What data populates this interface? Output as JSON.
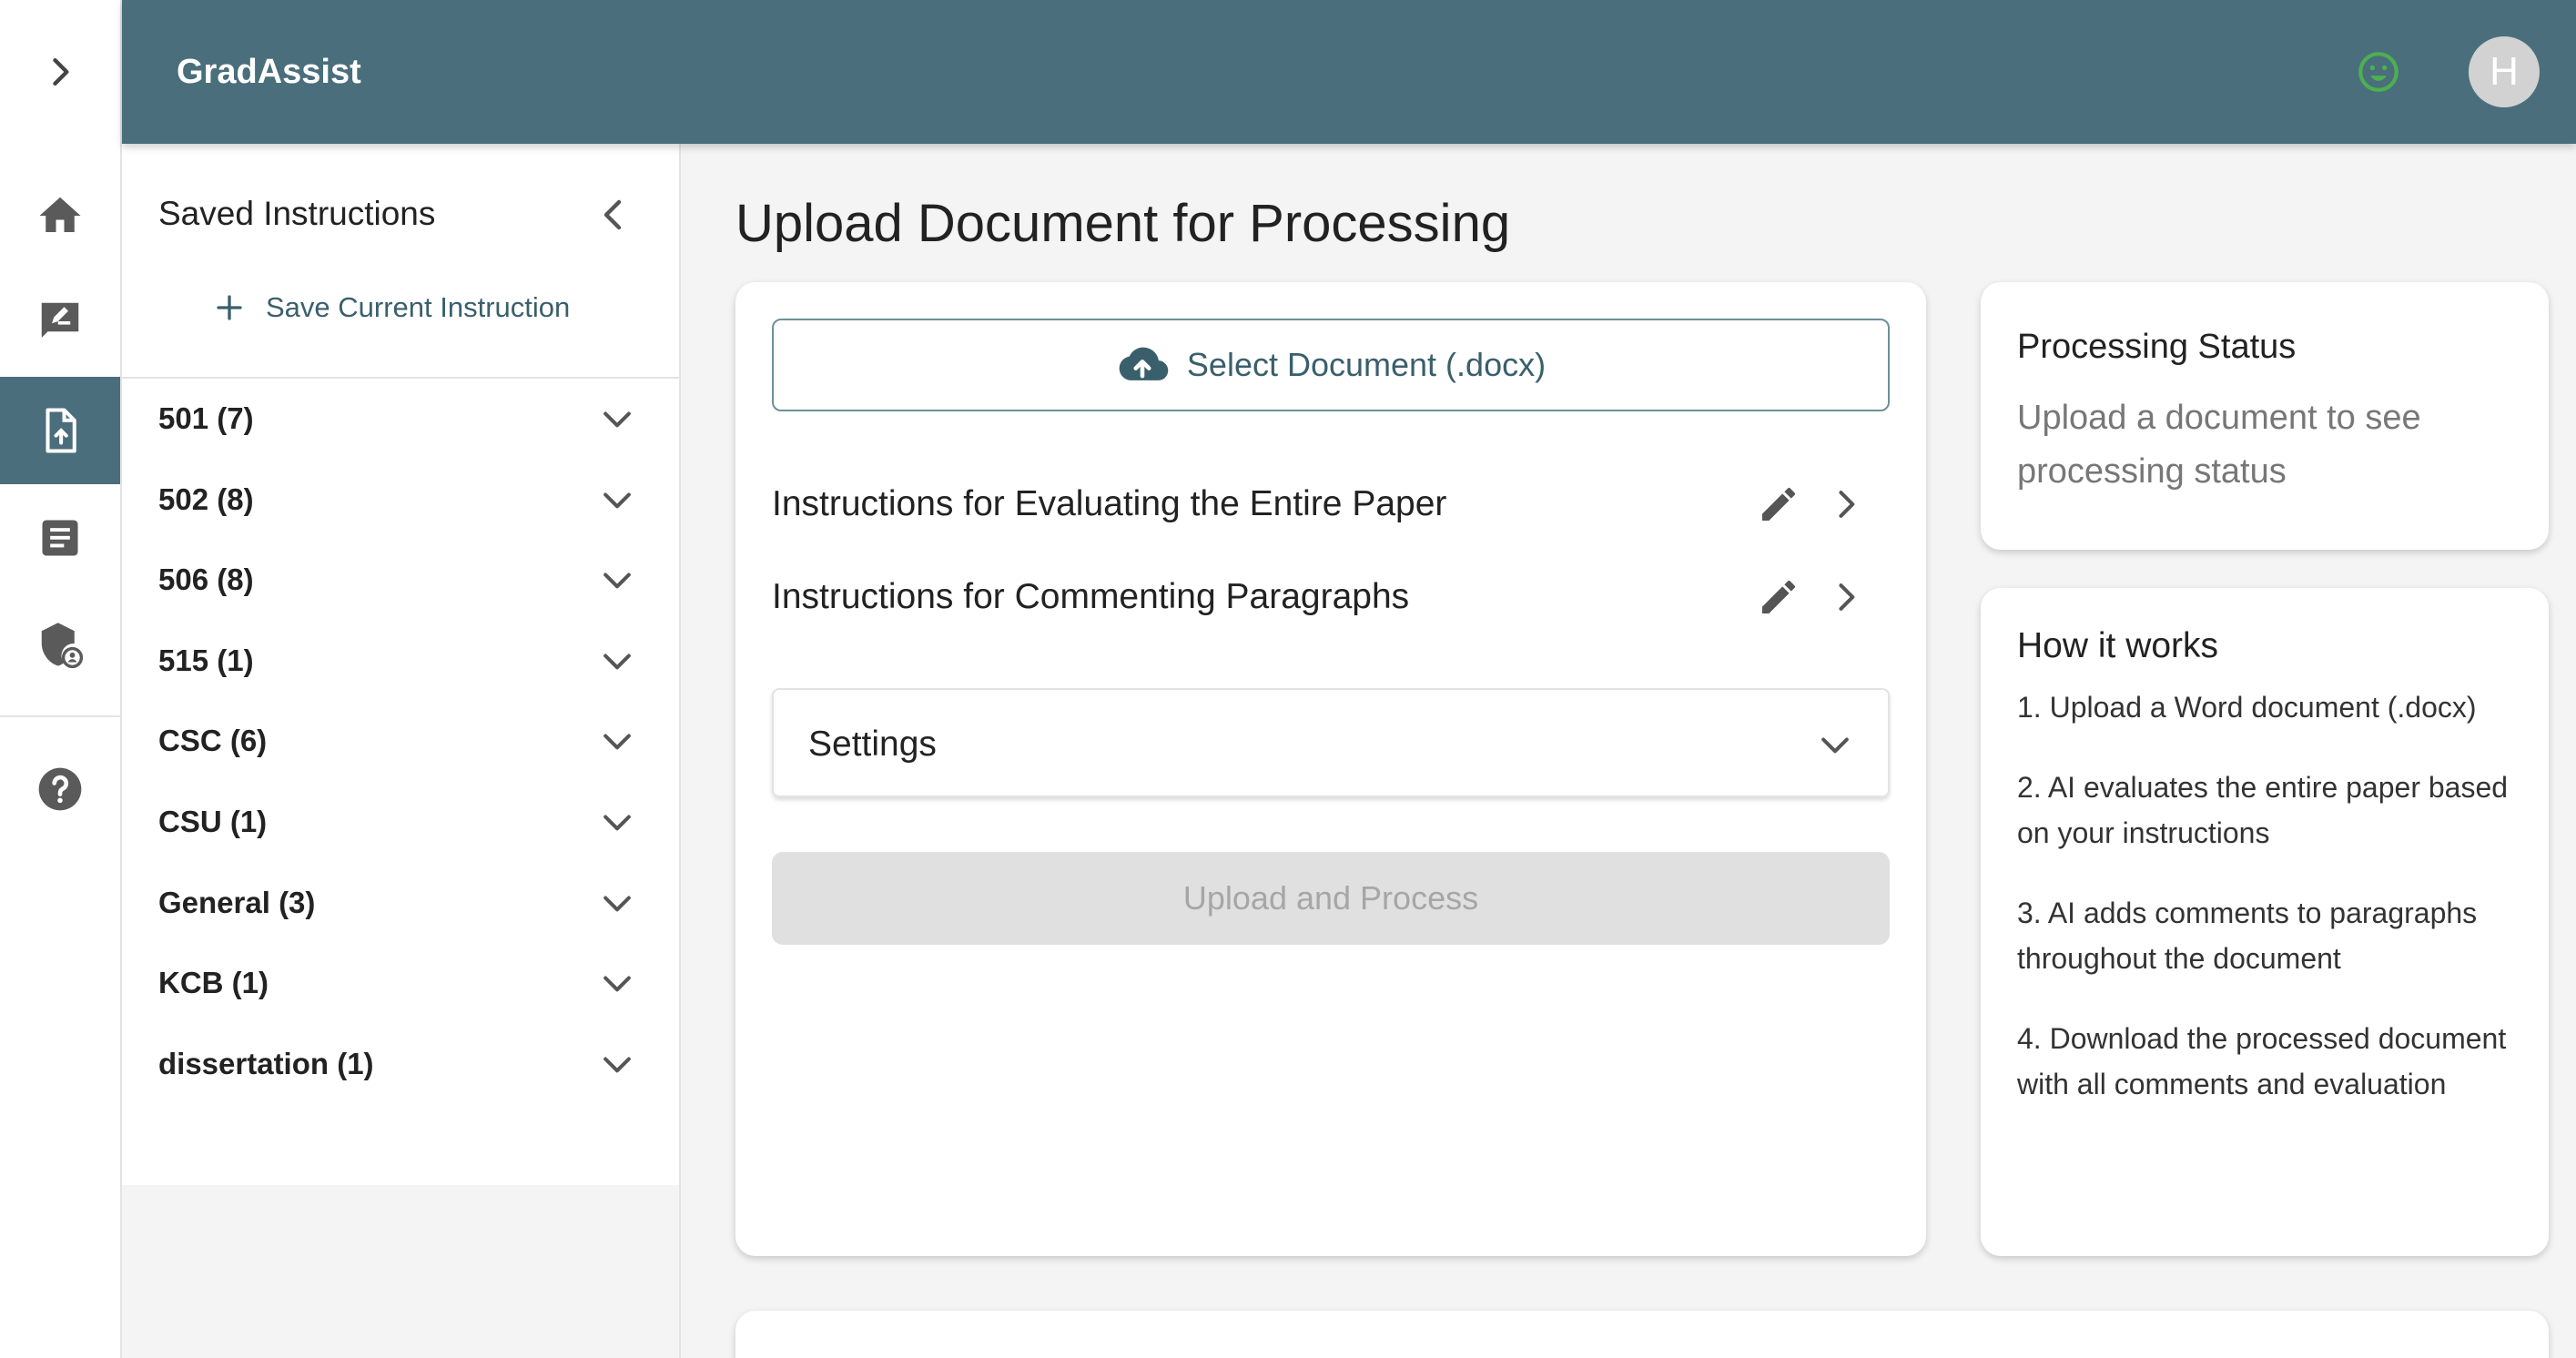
{
  "app": {
    "name": "GradAssist",
    "avatar_initial": "H"
  },
  "rail": {
    "items": [
      {
        "name": "home",
        "icon": "home-icon"
      },
      {
        "name": "grading",
        "icon": "edit-note-icon"
      },
      {
        "name": "upload",
        "icon": "file-upload-icon",
        "active": true
      },
      {
        "name": "documents",
        "icon": "article-icon"
      },
      {
        "name": "privacy",
        "icon": "admin-shield-icon"
      },
      {
        "name": "help",
        "icon": "help-icon"
      }
    ],
    "active_color": "#4a6e7b"
  },
  "sidebar": {
    "title": "Saved Instructions",
    "save_label": "Save Current Instruction",
    "groups": [
      {
        "label": "501 (7)"
      },
      {
        "label": "502 (8)"
      },
      {
        "label": "506 (8)"
      },
      {
        "label": "515 (1)"
      },
      {
        "label": "CSC (6)"
      },
      {
        "label": "CSU (1)"
      },
      {
        "label": "General (3)"
      },
      {
        "label": "KCB (1)"
      },
      {
        "label": "dissertation (1)"
      }
    ]
  },
  "main": {
    "page_title": "Upload Document for Processing",
    "select_label": "Select Document (.docx)",
    "instructions": [
      {
        "label": "Instructions for Evaluating the Entire Paper"
      },
      {
        "label": "Instructions for Commenting Paragraphs"
      }
    ],
    "settings_label": "Settings",
    "process_label": "Upload and Process"
  },
  "status": {
    "title": "Processing Status",
    "message": "Upload a document to see processing status"
  },
  "how": {
    "title": "How it works",
    "steps": [
      "1. Upload a Word document (.docx)",
      "2. AI evaluates the entire paper based on your instructions",
      "3. AI adds comments to paragraphs throughout the document",
      "4. Download the processed document with all comments and evaluation"
    ]
  },
  "colors": {
    "header": "#4a6e7b",
    "accent_text": "#3a5f6c",
    "status_ok": "#4caf50",
    "disabled_bg": "#e0e0e0"
  }
}
